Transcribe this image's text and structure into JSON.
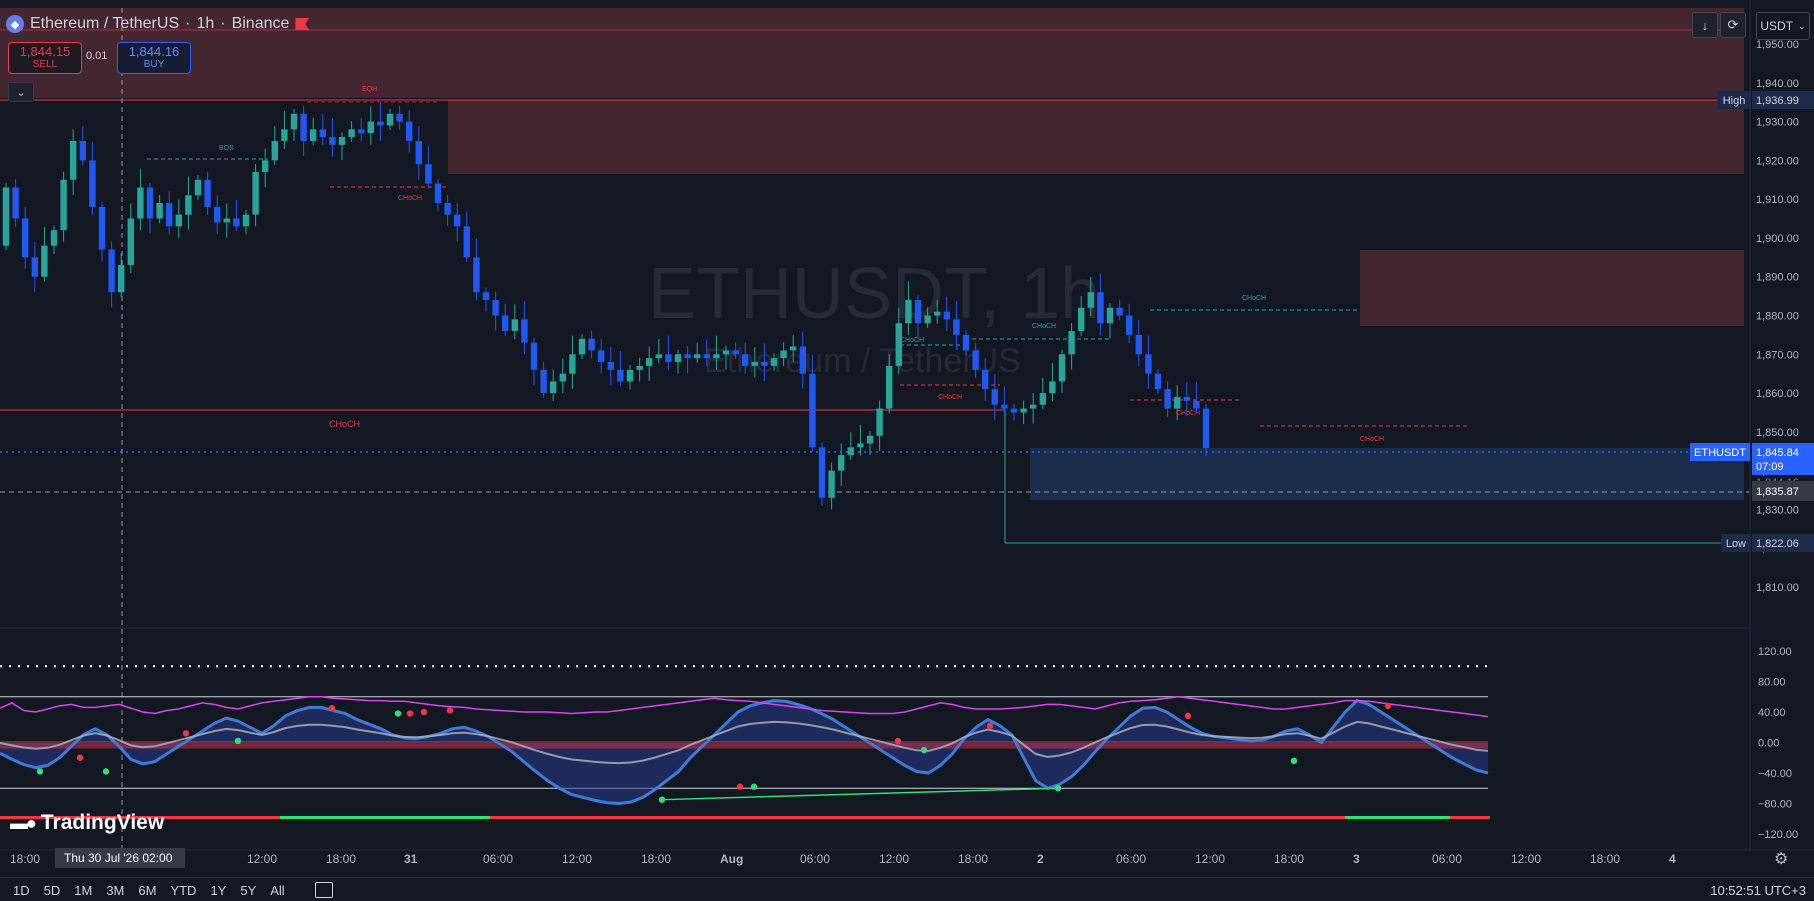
{
  "header": {
    "symbol": "Ethereum / TetherUS",
    "interval": "1h",
    "exchange": "Binance",
    "sell_price": "1,844.15",
    "sell_label": "SELL",
    "spread": "0.01",
    "buy_price": "1,844.16",
    "buy_label": "BUY",
    "collapse_icon": "chevron-down-icon"
  },
  "toolbar": {
    "currency": "USDT",
    "download_icon": "arrow-down-icon",
    "refresh_icon": "refresh-icon"
  },
  "watermark": {
    "ticker": "ETHUSDT, 1h",
    "name": "Ethereum / TetherUS"
  },
  "colors": {
    "bull": "#26a69a",
    "bear": "#2157f3",
    "bear_border": "#1e47d8",
    "supply_zone": "#5b2b3c",
    "demand_zone": "#1c3256",
    "choch_bear": "#f23645",
    "choch_bull": "#22ab94",
    "background": "#131722"
  },
  "price_axis": {
    "ticks": [
      "1,950.00",
      "1,940.00",
      "1,930.00",
      "1,920.00",
      "1,910.00",
      "1,900.00",
      "1,890.00",
      "1,880.00",
      "1,870.00",
      "1,860.00",
      "1,850.00",
      "1,840.00",
      "1,830.00",
      "1,820.00",
      "1,810.00"
    ],
    "tick_values": [
      1950,
      1940,
      1930,
      1920,
      1910,
      1900,
      1890,
      1880,
      1870,
      1860,
      1850,
      1840,
      1830,
      1820,
      1810
    ],
    "high_tag": "High",
    "high_value": "1,936.99",
    "current_tag": "ETHUSDT",
    "current_value": "1,845.84",
    "countdown": "07:09",
    "hidden_value": "1,844.16",
    "crosshair_value": "1,835.87",
    "low_tag": "Low",
    "low_value": "1,822.06"
  },
  "osc_axis": {
    "ticks": [
      "120.00",
      "80.00",
      "40.00",
      "0.00",
      "−40.00",
      "−80.00",
      "−120.00"
    ],
    "tick_values": [
      120,
      80,
      40,
      0,
      -40,
      -80,
      -120
    ]
  },
  "time_axis": {
    "ticks": [
      {
        "label": "18:00",
        "bold": false
      },
      {
        "label": "12:00",
        "bold": false
      },
      {
        "label": "18:00",
        "bold": false
      },
      {
        "label": "31",
        "bold": true
      },
      {
        "label": "06:00",
        "bold": false
      },
      {
        "label": "12:00",
        "bold": false
      },
      {
        "label": "18:00",
        "bold": false
      },
      {
        "label": "Aug",
        "bold": true
      },
      {
        "label": "06:00",
        "bold": false
      },
      {
        "label": "12:00",
        "bold": false
      },
      {
        "label": "18:00",
        "bold": false
      },
      {
        "label": "2",
        "bold": true
      },
      {
        "label": "06:00",
        "bold": false
      },
      {
        "label": "12:00",
        "bold": false
      },
      {
        "label": "18:00",
        "bold": false
      },
      {
        "label": "3",
        "bold": true
      },
      {
        "label": "06:00",
        "bold": false
      },
      {
        "label": "12:00",
        "bold": false
      },
      {
        "label": "18:00",
        "bold": false
      },
      {
        "label": "4",
        "bold": true
      }
    ],
    "crosshair_label": "Thu 30 Jul '26   02:00"
  },
  "annotations": {
    "bos": "BOS",
    "egh": "EQH",
    "choch": "CHoCH"
  },
  "chart_data": {
    "type": "candlestick",
    "symbol": "ETHUSDT",
    "interval": "1h",
    "high": 1936.99,
    "low": 1822.06,
    "last": 1845.84,
    "closes": [
      1913,
      1905,
      1895,
      1890,
      1898,
      1902,
      1915,
      1925,
      1920,
      1908,
      1897,
      1886,
      1893,
      1905,
      1913,
      1905,
      1909,
      1903,
      1906,
      1911,
      1915,
      1908,
      1904,
      1905,
      1903,
      1906,
      1917,
      1920,
      1925,
      1928,
      1932,
      1925,
      1928,
      1926,
      1924,
      1926,
      1928,
      1927,
      1930,
      1929,
      1932,
      1930,
      1925,
      1919,
      1914,
      1909,
      1906,
      1903,
      1895,
      1886,
      1884,
      1880,
      1876,
      1879,
      1873,
      1866,
      1860,
      1863,
      1865,
      1870,
      1874,
      1871,
      1868,
      1866,
      1863,
      1866,
      1867,
      1869,
      1870,
      1868,
      1870,
      1869,
      1870,
      1869,
      1870,
      1871,
      1870,
      1867,
      1868,
      1867,
      1869,
      1871,
      1872,
      1865,
      1846,
      1833,
      1840,
      1844,
      1846,
      1847,
      1849,
      1856,
      1867,
      1878,
      1884,
      1878,
      1880,
      1881,
      1879,
      1875,
      1871,
      1866,
      1861,
      1857,
      1856,
      1855,
      1856,
      1857,
      1860,
      1863,
      1870,
      1876,
      1882,
      1886,
      1878,
      1882,
      1880,
      1875,
      1870,
      1865,
      1861,
      1856,
      1859,
      1858,
      1856,
      1845.84
    ],
    "series": [
      {
        "name": "",
        "values": [
          -14,
          -22,
          -29,
          -33,
          -30,
          -20,
          -5,
          10,
          18,
          10,
          -5,
          -22,
          -28,
          -25,
          -15,
          -5,
          5,
          15,
          25,
          32,
          28,
          20,
          12,
          22,
          35,
          42,
          46,
          46,
          42,
          38,
          30,
          24,
          18,
          10,
          6,
          5,
          8,
          12,
          18,
          20,
          15,
          8,
          -2,
          -12,
          -25,
          -38,
          -50,
          -60,
          -68,
          -72,
          -76,
          -79,
          -80,
          -78,
          -72,
          -62,
          -50,
          -38,
          -20,
          -5,
          10,
          25,
          40,
          48,
          52,
          55,
          54,
          50,
          45,
          38,
          30,
          20,
          10,
          0,
          -10,
          -20,
          -30,
          -38,
          -40,
          -30,
          -15,
          5,
          20,
          30,
          22,
          10,
          -20,
          -50,
          -60,
          -55,
          -45,
          -30,
          -12,
          5,
          20,
          35,
          45,
          46,
          40,
          30,
          20,
          12,
          8,
          6,
          4,
          2,
          3,
          8,
          15,
          18,
          10,
          0,
          20,
          40,
          55,
          50,
          40,
          30,
          20,
          10,
          0,
          -10,
          -20,
          -28,
          -36,
          -40
        ]
      },
      {
        "name": "",
        "values": [
          45,
          52,
          42,
          40,
          44,
          48,
          50,
          46,
          46,
          48,
          50,
          45,
          40,
          38,
          42,
          44,
          48,
          52,
          50,
          46,
          44,
          48,
          52,
          54,
          56,
          58,
          60,
          60,
          58,
          57,
          56,
          55,
          55,
          54,
          54,
          52,
          50,
          48,
          47,
          46,
          44,
          43,
          42,
          41,
          40,
          40,
          40,
          39,
          38,
          39,
          40,
          40,
          42,
          44,
          46,
          48,
          50,
          52,
          54,
          56,
          58,
          56,
          55,
          54,
          52,
          50,
          48,
          46,
          44,
          42,
          41,
          40,
          39,
          38,
          38,
          38,
          40,
          44,
          48,
          52,
          50,
          46,
          44,
          44,
          44,
          45,
          46,
          48,
          50,
          50,
          48,
          46,
          44,
          48,
          52,
          54,
          55,
          56,
          58,
          60,
          58,
          56,
          54,
          52,
          50,
          48,
          46,
          44,
          44,
          46,
          48,
          50,
          52,
          55,
          55,
          54,
          52,
          50,
          48,
          46,
          44,
          42,
          40,
          38,
          36,
          34
        ]
      }
    ],
    "osc_ylim": [
      -130,
      125
    ]
  }
}
